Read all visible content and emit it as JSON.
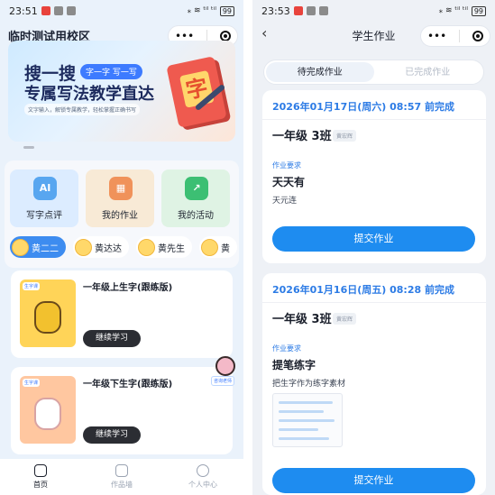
{
  "left": {
    "status": {
      "time": "23:51",
      "signal_text": "⁎ ≋ ᵗⁱˡ ᵗⁱˡ",
      "battery": "99"
    },
    "capsule": {
      "more": "•••"
    },
    "school_title": "临时测试用校区",
    "banner": {
      "line1": "搜一搜",
      "tag": "字一字 写一写",
      "line2": "专属写法教学直达",
      "sub": "文字输入，解锁专属教学，轻松掌握正确书写",
      "book_char": "字"
    },
    "menu": [
      {
        "label": "写字点评",
        "icon": "AI"
      },
      {
        "label": "我的作业",
        "icon": "▦"
      },
      {
        "label": "我的活动",
        "icon": "↗"
      }
    ],
    "students": [
      "黄二二",
      "黄达达",
      "黄先生",
      "黄"
    ],
    "courses": [
      {
        "title": "一年级上生字(跟练版)",
        "tag": "生字课",
        "button": "继续学习"
      },
      {
        "title": "一年级下生字(跟练版)",
        "tag": "生字课",
        "button": "继续学习"
      }
    ],
    "consult_label": "咨询老师",
    "tabs": [
      {
        "label": "首页",
        "icon": "home-icon"
      },
      {
        "label": "作品墙",
        "icon": "gallery-icon"
      },
      {
        "label": "个人中心",
        "icon": "profile-icon"
      }
    ]
  },
  "right": {
    "status": {
      "time": "23:53",
      "signal_text": "⁎ ≋ ᵗⁱˡ ᵗⁱˡ",
      "battery": "99"
    },
    "capsule": {
      "more": "•••"
    },
    "back": "‹",
    "title": "学生作业",
    "segments": [
      "待完成作业",
      "已完成作业"
    ],
    "homeworks": [
      {
        "deadline": "2026年01月17日(周六) 08:57 前完成",
        "class": "一年级 3班",
        "teacher": "黄宏辉",
        "req_label": "作业要求",
        "req_title": "天天有",
        "req_desc": "天元连",
        "submit": "提交作业"
      },
      {
        "deadline": "2026年01月16日(周五) 08:28 前完成",
        "class": "一年级 3班",
        "teacher": "黄宏辉",
        "req_label": "作业要求",
        "req_title": "提笔练字",
        "req_desc": "把生字作为练字素材",
        "submit": "提交作业"
      }
    ]
  }
}
